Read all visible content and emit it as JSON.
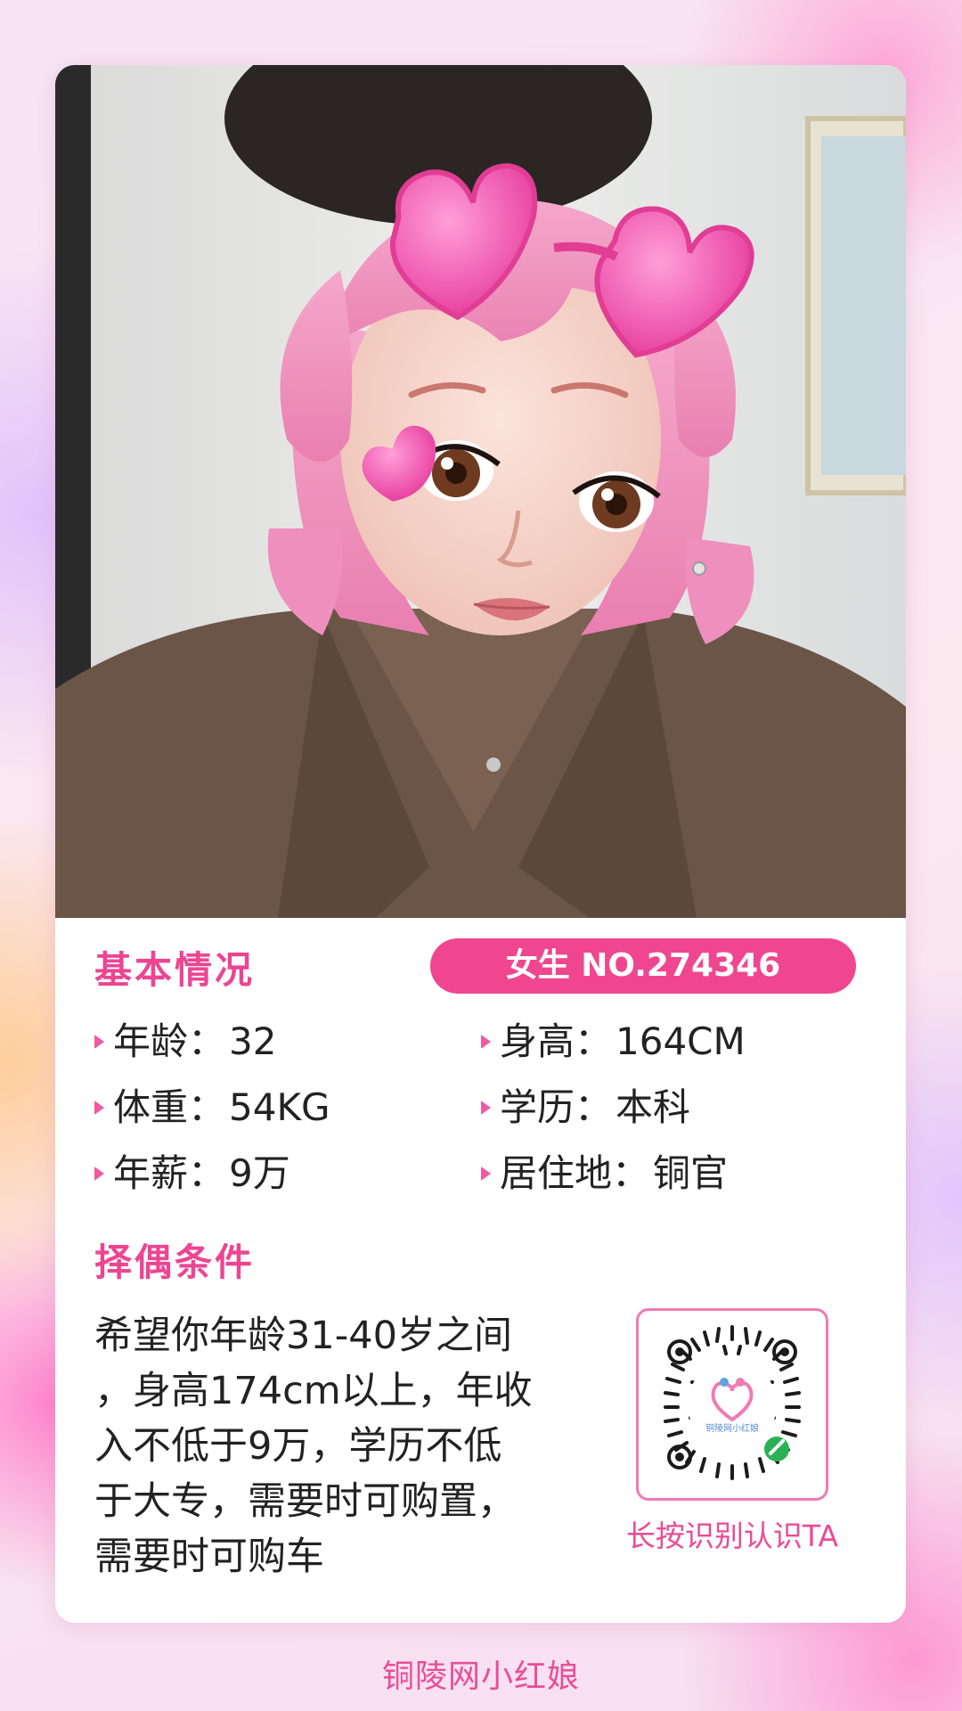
{
  "profile": {
    "basic_title": "基本情况",
    "id_badge": "女生 NO.274346",
    "fields": {
      "age": {
        "label": "年龄：",
        "value": "32"
      },
      "height": {
        "label": "身高：",
        "value": "164CM"
      },
      "weight": {
        "label": "体重：",
        "value": "54KG"
      },
      "education": {
        "label": "学历：",
        "value": "本科"
      },
      "salary": {
        "label": "年薪：",
        "value": "9万"
      },
      "residence": {
        "label": "居住地：",
        "value": "铜官"
      }
    },
    "pref_title": "择偶条件",
    "pref_lines": [
      "希望你年龄31-40岁之间",
      "，身高174cm以上，年收",
      "入不低于9万，学历不低",
      "于大专，需要时可购置，",
      "需要时可购车"
    ]
  },
  "qr": {
    "center_text": "铜陵网小红娘",
    "caption": "长按识别认识TA"
  },
  "footer": {
    "brand": "铜陵网小红娘"
  },
  "colors": {
    "accent": "#ec4592",
    "badge": "#f0468f",
    "coat": "#6b5547",
    "hair": "#f39cc4"
  }
}
